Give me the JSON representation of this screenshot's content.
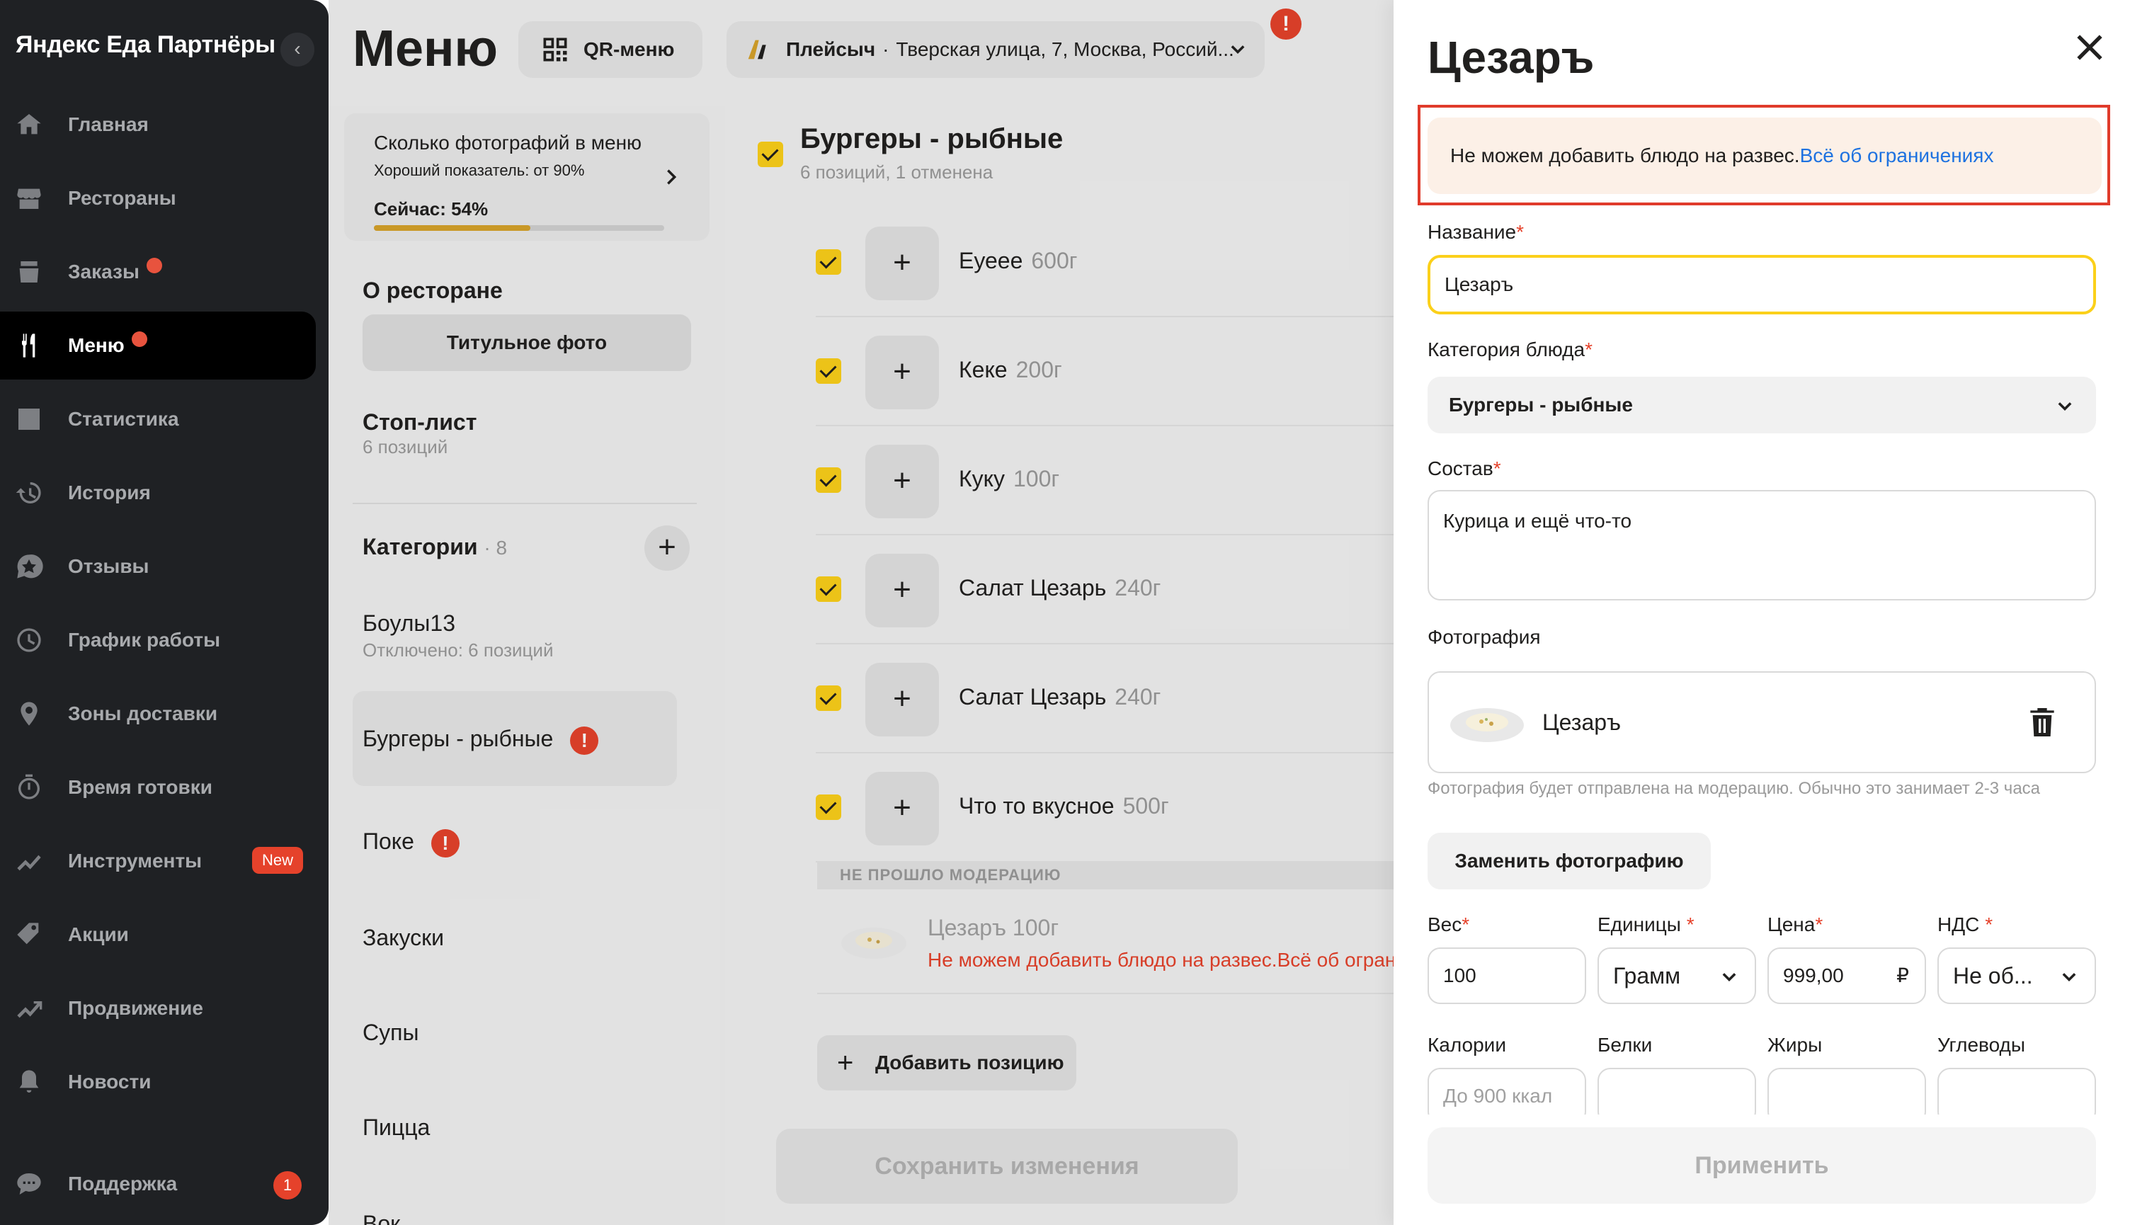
{
  "sidebar": {
    "brand": "Яндекс Еда Партнёры",
    "items": [
      {
        "label": "Главная",
        "icon": "home-icon"
      },
      {
        "label": "Рестораны",
        "icon": "store-icon"
      },
      {
        "label": "Заказы",
        "icon": "orders-icon",
        "dot": true
      },
      {
        "label": "Меню",
        "icon": "fork-knife-icon",
        "dot": true,
        "active": true
      },
      {
        "label": "Статистика",
        "icon": "chart-icon"
      },
      {
        "label": "История",
        "icon": "history-icon"
      },
      {
        "label": "Отзывы",
        "icon": "reviews-icon"
      },
      {
        "label": "График работы",
        "icon": "clock-icon"
      },
      {
        "label": "Зоны доставки",
        "icon": "pin-icon"
      },
      {
        "label": "Время готовки",
        "icon": "timer-icon"
      },
      {
        "label": "Инструменты",
        "icon": "tools-icon",
        "badge": "New"
      },
      {
        "label": "Акции",
        "icon": "tag-icon"
      },
      {
        "label": "Продвижение",
        "icon": "trend-icon"
      },
      {
        "label": "Новости",
        "icon": "bell-icon"
      }
    ],
    "support": {
      "label": "Поддержка",
      "icon": "chat-icon",
      "count": "1"
    }
  },
  "header": {
    "title": "Меню",
    "qr_label": "QR-меню",
    "place_name": "Плейсыч",
    "place_sep": "·",
    "place_address": "Тверская улица, 7, Москва, Россий...",
    "alert": "!"
  },
  "photo_card": {
    "title": "Сколько фотографий в меню",
    "subtitle": "Хороший показатель: от 90%",
    "now": "Сейчас: 54%",
    "progress": 0.54
  },
  "left": {
    "about": "О ресторане",
    "title_photo": "Титульное фото",
    "stop_title": "Стоп-лист",
    "stop_sub": "6 позиций",
    "categories_label": "Категории",
    "categories_count": "· 8",
    "categories": [
      {
        "name": "Боулы13",
        "sub": "Отключено: 6 позиций"
      },
      {
        "name": "Бургеры - рыбные",
        "error": "!",
        "selected": true
      },
      {
        "name": "Поке",
        "error": "!"
      },
      {
        "name": "Закуски"
      },
      {
        "name": "Супы"
      },
      {
        "name": "Пицца"
      },
      {
        "name": "Вок"
      }
    ]
  },
  "category": {
    "title": "Бургеры - рыбные",
    "subtitle": "6 позиций, 1 отменена",
    "dishes": [
      {
        "name": "Еуеее",
        "weight": "600г"
      },
      {
        "name": "Кеке",
        "weight": "200г"
      },
      {
        "name": "Куку",
        "weight": "100г"
      },
      {
        "name": "Салат Цезарь",
        "weight": "240г"
      },
      {
        "name": "Салат Цезарь",
        "weight": "240г"
      },
      {
        "name": "Что то вкусное",
        "weight": "500г"
      }
    ],
    "moderation_label": "НЕ ПРОШЛО МОДЕРАЦИЮ",
    "rejected": {
      "name": "Цезаръ 100г",
      "error": "Не можем добавить блюдо на развес.Всё об огран"
    },
    "add_label": "Добавить позицию",
    "save_label": "Сохранить изменения"
  },
  "panel": {
    "title": "Цезаръ",
    "warning_text": "Не можем добавить блюдо на развес.",
    "warning_link": "Всё об ограничениях",
    "name_label": "Название",
    "name_value": "Цезаръ",
    "category_label": "Категория блюда",
    "category_value": "Бургеры - рыбные",
    "composition_label": "Состав",
    "composition_value": "Курица и ещё что-то",
    "photo_label": "Фотография",
    "photo_name": "Цезаръ",
    "photo_note": "Фотография будет отправлена на модерацию. Обычно это занимает 2-3 часа",
    "replace_label": "Заменить фотографию",
    "weight_label": "Вес",
    "weight_value": "100",
    "units_label": "Единицы",
    "units_value": "Грамм",
    "price_label": "Цена",
    "price_value": "999,00",
    "currency": "₽",
    "vat_label": "НДС",
    "vat_value": "Не об...",
    "calories_label": "Калории",
    "calories_placeholder": "До 900 ккал",
    "protein_label": "Белки",
    "fat_label": "Жиры",
    "carbs_label": "Углеводы",
    "required_mark": "*",
    "apply_label": "Применить"
  },
  "colors": {
    "accent_yellow": "#fbd01a",
    "error_red": "#e5422b",
    "link_blue": "#1e72e0",
    "sidebar_bg": "#1f2124"
  }
}
